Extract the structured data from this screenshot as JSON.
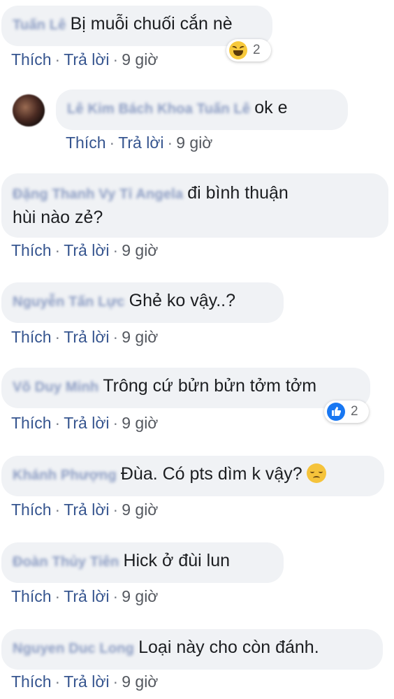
{
  "comments": [
    {
      "name": "Tuấn Lê",
      "text": "Bị muỗi chuối cắn nè",
      "like_label": "Thích",
      "reply_label": "Trả lời",
      "time": "9 giờ",
      "reaction": {
        "icon": "haha-icon",
        "count": "2"
      }
    },
    {
      "name": "Lê Kim Bách Khoa Tuấn Lê",
      "text": "ok e",
      "like_label": "Thích",
      "reply_label": "Trả lời",
      "time": "9 giờ",
      "is_reply": true
    },
    {
      "name": "Đặng Thanh Vy Tỉ Angela",
      "text": "đi bình thuận hùi nào zẻ?",
      "text_line1": "đi bình thuận",
      "text_line2": "hùi nào zẻ?",
      "like_label": "Thích",
      "reply_label": "Trả lời",
      "time": "9 giờ"
    },
    {
      "name": "Nguyễn Tấn Lực",
      "text": "Ghẻ ko vậy..?",
      "like_label": "Thích",
      "reply_label": "Trả lời",
      "time": "9 giờ"
    },
    {
      "name": "Võ Duy Minh",
      "text": "Trông cứ bửn bửn tởm tởm",
      "like_label": "Thích",
      "reply_label": "Trả lời",
      "time": "9 giờ",
      "reaction": {
        "icon": "like-icon",
        "count": "2"
      }
    },
    {
      "name": "Khánh Phượng",
      "text": "Đùa. Có pts dìm k vậy?",
      "emoji": "sad-icon",
      "like_label": "Thích",
      "reply_label": "Trả lời",
      "time": "9 giờ"
    },
    {
      "name": "Đoàn Thủy Tiên",
      "text": "Hick ở đùi lun",
      "like_label": "Thích",
      "reply_label": "Trả lời",
      "time": "9 giờ"
    },
    {
      "name": "Nguyen Duc Long",
      "text": "Loại này cho còn đánh.",
      "like_label": "Thích",
      "reply_label": "Trả lời",
      "time": "9 giờ"
    }
  ],
  "separator": "·",
  "colors": {
    "bubble": "#f0f2f5",
    "link": "#36558f",
    "like_blue": "#1877f2",
    "haha_yellow": "#f7c93c"
  }
}
